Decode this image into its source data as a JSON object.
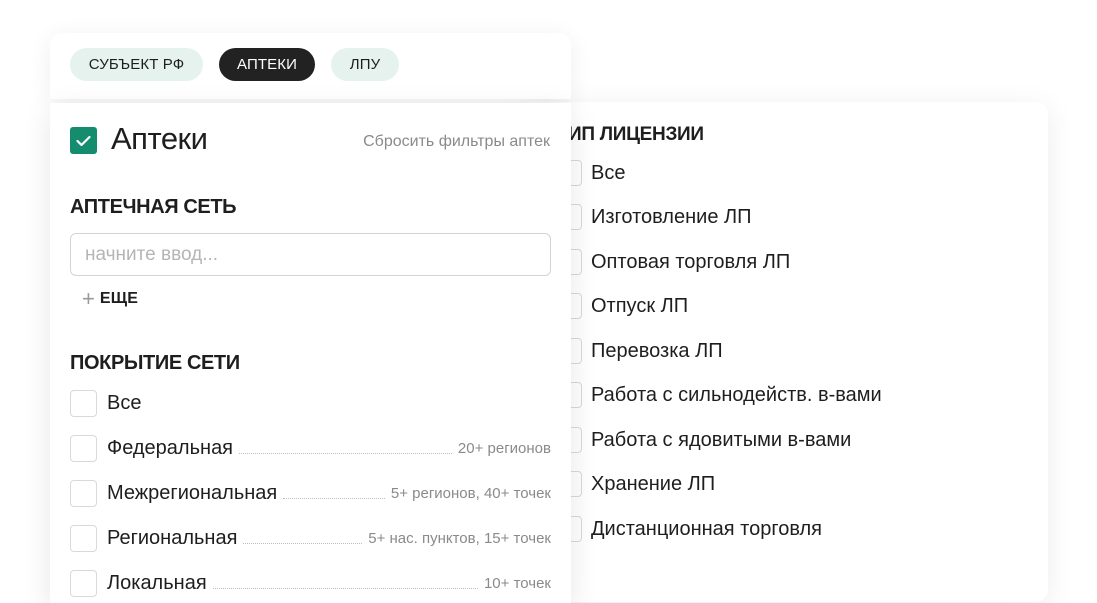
{
  "tabs": [
    {
      "label": "СУБЪЕКТ РФ",
      "active": false
    },
    {
      "label": "АПТЕКИ",
      "active": true
    },
    {
      "label": "ЛПУ",
      "active": false
    }
  ],
  "pharmacies": {
    "title": "Аптеки",
    "checked": true,
    "reset_label": "Сбросить фильтры аптек",
    "chain": {
      "title": "АПТЕЧНАЯ СЕТЬ",
      "placeholder": "начните ввод...",
      "value": "",
      "more_label": "ЕЩЕ"
    },
    "coverage": {
      "title": "ПОКРЫТИЕ СЕТИ",
      "items": [
        {
          "label": "Все",
          "desc": ""
        },
        {
          "label": "Федеральная",
          "desc": "20+ регионов"
        },
        {
          "label": "Межрегиональная",
          "desc": "5+ регионов, 40+ точек"
        },
        {
          "label": "Региональная",
          "desc": "5+ нас. пунктов, 15+ точек"
        },
        {
          "label": "Локальная",
          "desc": "10+ точек"
        }
      ]
    }
  },
  "license": {
    "title": "ИП ЛИЦЕНЗИИ",
    "items": [
      "Все",
      "Изготовление ЛП",
      "Оптовая торговля ЛП",
      "Отпуск ЛП",
      "Перевозка ЛП",
      "Работа с сильнодейств. в-вами",
      "Работа с ядовитыми в-вами",
      "Хранение ЛП",
      "Дистанционная торговля"
    ]
  },
  "colors": {
    "accent": "#158c6e",
    "tab_light": "#e6f2ee",
    "tab_dark": "#222222"
  }
}
